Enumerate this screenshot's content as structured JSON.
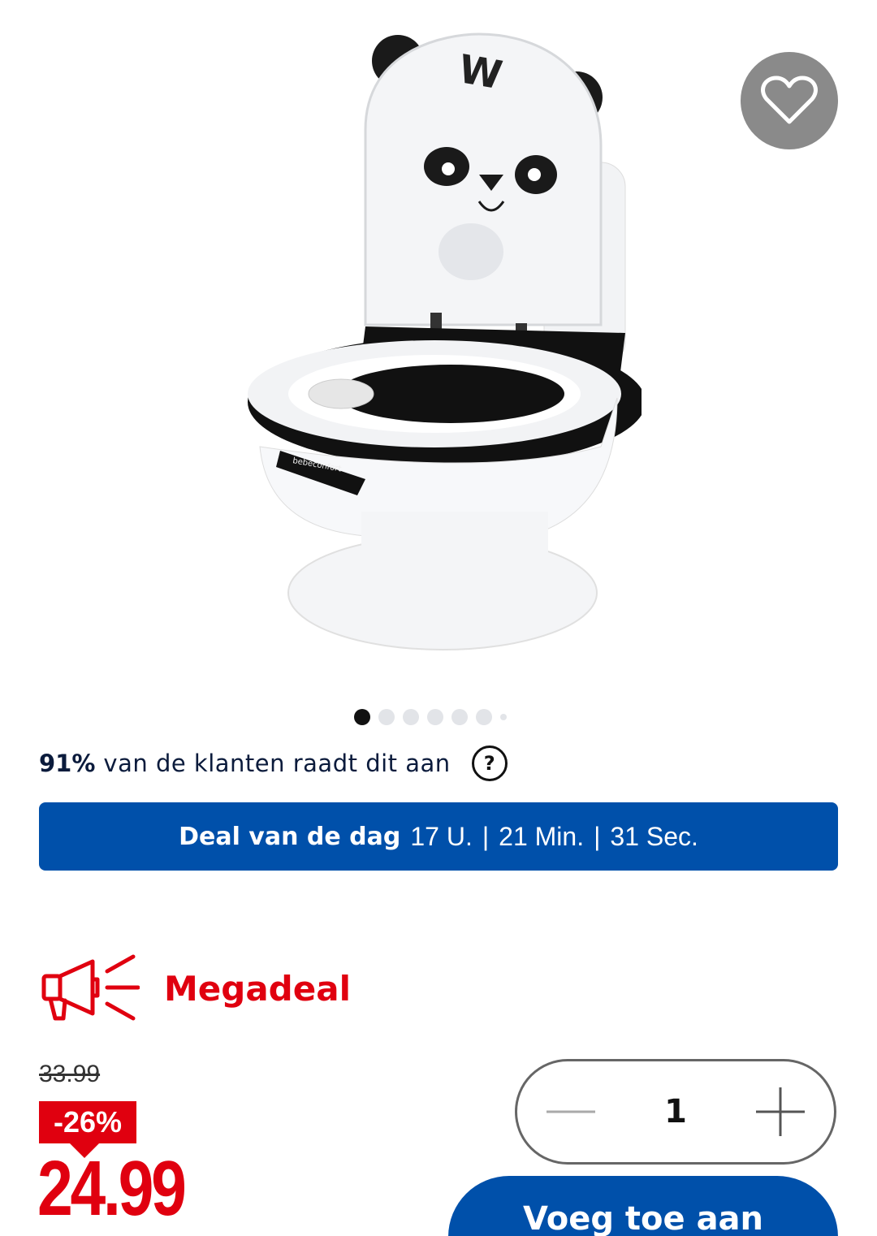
{
  "product": {
    "image_alt": "Panda kinderwc-potje",
    "brand_mark": "bebeconfort"
  },
  "wishlist": {
    "icon": "heart-outline-icon"
  },
  "carousel": {
    "total": 7,
    "active_index": 0
  },
  "recommendation": {
    "percent": "91%",
    "text": "van de klanten raadt dit aan",
    "help_symbol": "?"
  },
  "deal": {
    "label": "Deal van de dag",
    "hours": "17 U.",
    "minutes": "21 Min.",
    "seconds": "31 Sec.",
    "separator": "|"
  },
  "megadeal": {
    "label": "Megadeal",
    "icon": "megaphone-icon",
    "color": "#e0000f"
  },
  "pricing": {
    "old_price": "33.99",
    "discount": "-26%",
    "price": "24.99"
  },
  "quantity": {
    "value": "1"
  },
  "cart": {
    "button_label": "Voeg toe aan"
  },
  "colors": {
    "brand_blue": "#0050aa",
    "sale_red": "#e0000f"
  }
}
